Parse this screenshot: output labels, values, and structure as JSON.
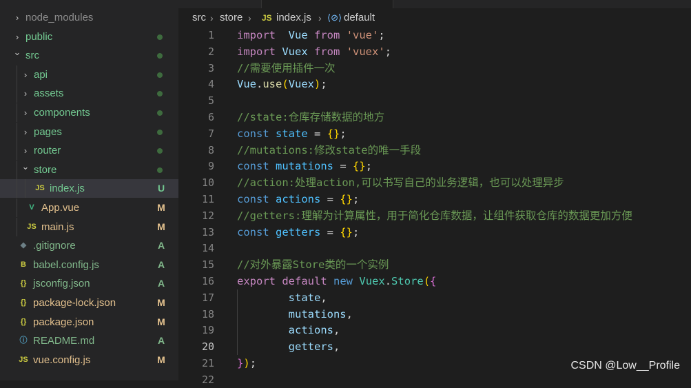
{
  "explorer": {
    "items": [
      {
        "label": "node_modules",
        "kind": "folder",
        "open": false,
        "depth": 0,
        "status": "",
        "dimmed": true
      },
      {
        "label": "public",
        "kind": "folder",
        "open": false,
        "depth": 0,
        "status": "dot"
      },
      {
        "label": "src",
        "kind": "folder",
        "open": true,
        "depth": 0,
        "status": "dot"
      },
      {
        "label": "api",
        "kind": "folder",
        "open": false,
        "depth": 1,
        "status": "dot"
      },
      {
        "label": "assets",
        "kind": "folder",
        "open": false,
        "depth": 1,
        "status": "dot"
      },
      {
        "label": "components",
        "kind": "folder",
        "open": false,
        "depth": 1,
        "status": "dot"
      },
      {
        "label": "pages",
        "kind": "folder",
        "open": false,
        "depth": 1,
        "status": "dot"
      },
      {
        "label": "router",
        "kind": "folder",
        "open": false,
        "depth": 1,
        "status": "dot"
      },
      {
        "label": "store",
        "kind": "folder",
        "open": true,
        "depth": 1,
        "status": "dot"
      },
      {
        "label": "index.js",
        "kind": "js",
        "depth": 2,
        "status": "U",
        "selected": true
      },
      {
        "label": "App.vue",
        "kind": "vue",
        "depth": 1,
        "status": "M"
      },
      {
        "label": "main.js",
        "kind": "js",
        "depth": 1,
        "status": "M"
      },
      {
        "label": ".gitignore",
        "kind": "git",
        "depth": 0,
        "status": "A"
      },
      {
        "label": "babel.config.js",
        "kind": "babel",
        "depth": 0,
        "status": "A"
      },
      {
        "label": "jsconfig.json",
        "kind": "json",
        "depth": 0,
        "status": "A"
      },
      {
        "label": "package-lock.json",
        "kind": "json",
        "depth": 0,
        "status": "M"
      },
      {
        "label": "package.json",
        "kind": "json",
        "depth": 0,
        "status": "M"
      },
      {
        "label": "README.md",
        "kind": "info",
        "depth": 0,
        "status": "A"
      },
      {
        "label": "vue.config.js",
        "kind": "js",
        "depth": 0,
        "status": "M"
      }
    ]
  },
  "breadcrumb": {
    "part1": "src",
    "part2": "store",
    "badge": "JS",
    "part3": "index.js",
    "part4": "default"
  },
  "editor": {
    "current_line": 20,
    "lines": [
      [
        [
          "kw",
          "import"
        ],
        [
          "",
          "  "
        ],
        [
          "var",
          "Vue"
        ],
        [
          "",
          " "
        ],
        [
          "kw",
          "from"
        ],
        [
          "",
          " "
        ],
        [
          "str",
          "'vue'"
        ],
        [
          "",
          ";"
        ]
      ],
      [
        [
          "kw",
          "import"
        ],
        [
          "",
          " "
        ],
        [
          "var",
          "Vuex"
        ],
        [
          "",
          " "
        ],
        [
          "kw",
          "from"
        ],
        [
          "",
          " "
        ],
        [
          "str",
          "'vuex'"
        ],
        [
          "",
          ";"
        ]
      ],
      [
        [
          "cmt",
          "//需要使用插件一次"
        ]
      ],
      [
        [
          "var",
          "Vue"
        ],
        [
          "",
          "."
        ],
        [
          "fn",
          "use"
        ],
        [
          "br1",
          "("
        ],
        [
          "var",
          "Vuex"
        ],
        [
          "br1",
          ")"
        ],
        [
          "",
          ";"
        ]
      ],
      [],
      [
        [
          "cmt",
          "//state:仓库存储数据的地方"
        ]
      ],
      [
        [
          "kw2",
          "const"
        ],
        [
          "",
          " "
        ],
        [
          "cnst",
          "state"
        ],
        [
          "",
          " = "
        ],
        [
          "br1",
          "{}"
        ],
        [
          "",
          ";"
        ]
      ],
      [
        [
          "cmt",
          "//mutations:修改state的唯一手段"
        ]
      ],
      [
        [
          "kw2",
          "const"
        ],
        [
          "",
          " "
        ],
        [
          "cnst",
          "mutations"
        ],
        [
          "",
          " = "
        ],
        [
          "br1",
          "{}"
        ],
        [
          "",
          ";"
        ]
      ],
      [
        [
          "cmt",
          "//action:处理action,可以书写自己的业务逻辑，也可以处理异步"
        ]
      ],
      [
        [
          "kw2",
          "const"
        ],
        [
          "",
          " "
        ],
        [
          "cnst",
          "actions"
        ],
        [
          "",
          " = "
        ],
        [
          "br1",
          "{}"
        ],
        [
          "",
          ";"
        ]
      ],
      [
        [
          "cmt",
          "//getters:理解为计算属性，用于简化仓库数据，让组件获取仓库的数据更加方便"
        ]
      ],
      [
        [
          "kw2",
          "const"
        ],
        [
          "",
          " "
        ],
        [
          "cnst",
          "getters"
        ],
        [
          "",
          " = "
        ],
        [
          "br1",
          "{}"
        ],
        [
          "",
          ";"
        ]
      ],
      [],
      [
        [
          "cmt",
          "//对外暴露Store类的一个实例"
        ]
      ],
      [
        [
          "kw",
          "export"
        ],
        [
          "",
          " "
        ],
        [
          "kw",
          "default"
        ],
        [
          "",
          " "
        ],
        [
          "kw2",
          "new"
        ],
        [
          "",
          " "
        ],
        [
          "cls",
          "Vuex"
        ],
        [
          "",
          "."
        ],
        [
          "cls",
          "Store"
        ],
        [
          "br1",
          "("
        ],
        [
          "br2",
          "{"
        ]
      ],
      [
        [
          "",
          "        "
        ],
        [
          "var",
          "state"
        ],
        [
          "",
          ","
        ]
      ],
      [
        [
          "",
          "        "
        ],
        [
          "var",
          "mutations"
        ],
        [
          "",
          ","
        ]
      ],
      [
        [
          "",
          "        "
        ],
        [
          "var",
          "actions"
        ],
        [
          "",
          ","
        ]
      ],
      [
        [
          "",
          "        "
        ],
        [
          "var",
          "getters"
        ],
        [
          "",
          ","
        ]
      ],
      [
        [
          "br2",
          "}"
        ],
        [
          "br1",
          ")"
        ],
        [
          "",
          ";"
        ]
      ],
      []
    ],
    "line_numbers": [
      "1",
      "2",
      "3",
      "4",
      "5",
      "6",
      "7",
      "8",
      "9",
      "10",
      "11",
      "12",
      "13",
      "14",
      "15",
      "16",
      "17",
      "18",
      "19",
      "20",
      "21",
      "22"
    ]
  },
  "watermark": "CSDN @Low__Profile",
  "colors": {
    "bg": "#1e1e1e",
    "sidebar": "#252526",
    "selected": "#37373d"
  }
}
